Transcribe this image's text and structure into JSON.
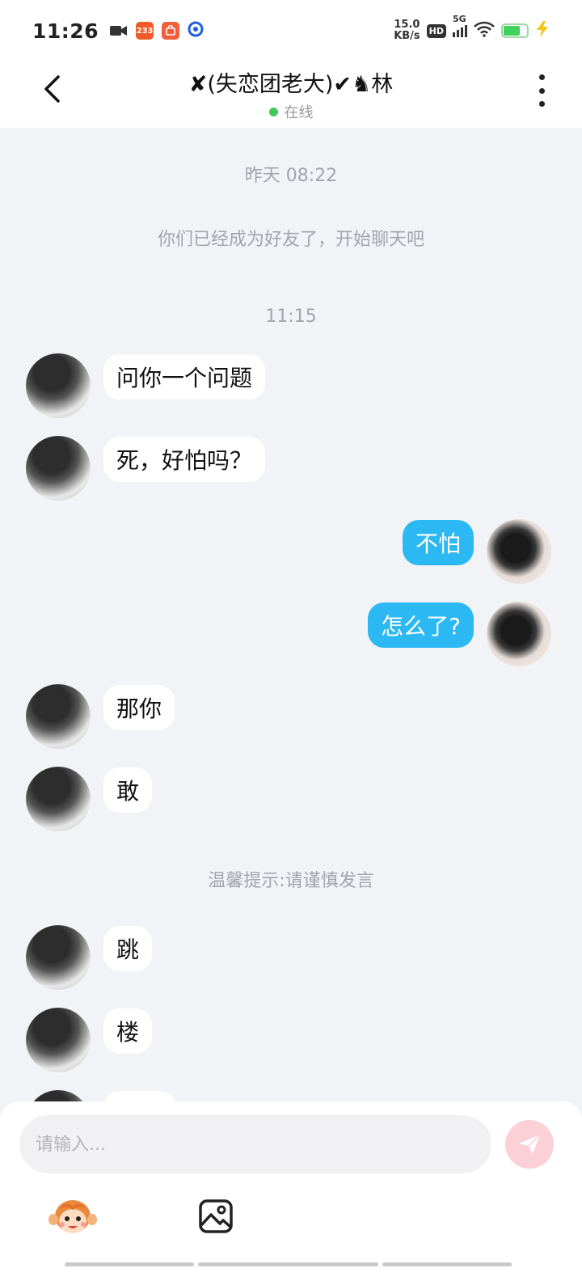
{
  "status_bar": {
    "time": "11:26",
    "app_badge_233": "233",
    "net_speed_value": "15.0",
    "net_speed_unit": "KB/s",
    "hd_label": "HD",
    "network_label": "5G"
  },
  "header": {
    "title": "✘(失恋团老大)✔♞林",
    "status": "在线"
  },
  "chat": {
    "system_time_1": "昨天 08:22",
    "system_friend_notice": "你们已经成为好友了，开始聊天吧",
    "system_time_2": "11:15",
    "warning_notice": "温馨提示:请谨慎发言",
    "messages": [
      {
        "side": "left",
        "text": "问你一个问题"
      },
      {
        "side": "left",
        "text": "死，好怕吗？"
      },
      {
        "side": "right",
        "text": "不怕"
      },
      {
        "side": "right",
        "text": "怎么了?"
      },
      {
        "side": "left",
        "text": "那你"
      },
      {
        "side": "left",
        "text": "敢"
      },
      {
        "side": "left",
        "text": "跳"
      },
      {
        "side": "left",
        "text": "楼"
      }
    ]
  },
  "input": {
    "placeholder": "请输入..."
  },
  "colors": {
    "background": "#f2f3f7",
    "sent_bubble": "#2cb8f2",
    "online_dot": "#3ccc5a",
    "send_button": "#fbd0d6"
  },
  "icons": {
    "back": "chevron-left-icon",
    "more": "more-vertical-icon",
    "send": "paper-plane-icon",
    "emoji": "monkey-emoji-icon",
    "image": "image-icon"
  }
}
